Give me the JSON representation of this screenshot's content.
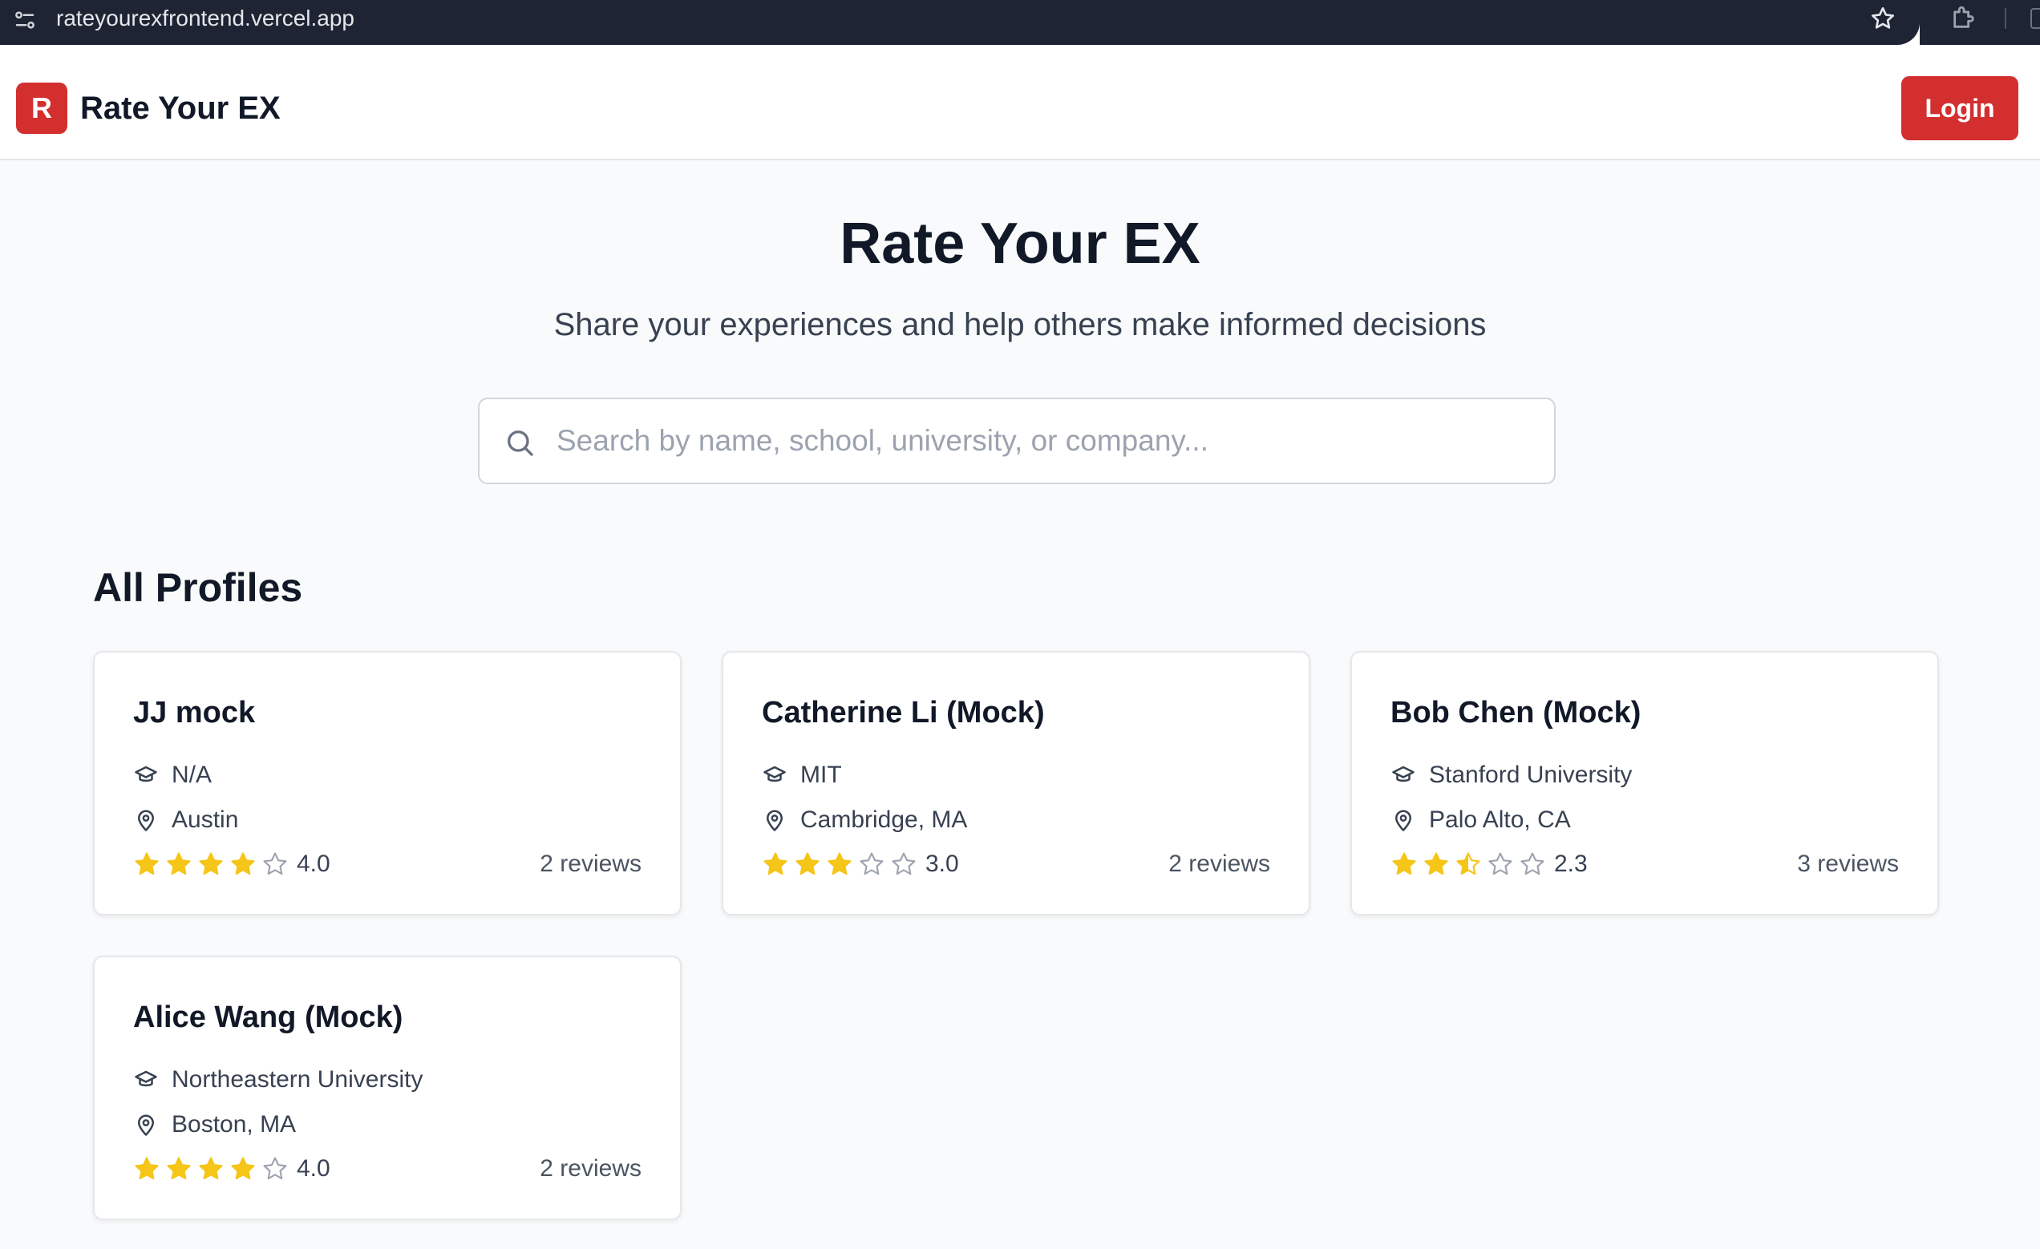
{
  "browser": {
    "url": "rateyourexfrontend.vercel.app",
    "icons": [
      "site-settings-icon",
      "star-icon",
      "extensions-icon"
    ]
  },
  "header": {
    "logo_letter": "R",
    "logo_text": "Rate Your EX",
    "login_label": "Login",
    "accent_color": "#d32f2f"
  },
  "hero": {
    "title": "Rate Your EX",
    "subtitle": "Share your experiences and help others make informed decisions"
  },
  "search": {
    "placeholder": "Search by name, school, university, or company...",
    "value": ""
  },
  "section_title": "All Profiles",
  "profiles": [
    {
      "name": "JJ mock",
      "school": "N/A",
      "location": "Austin",
      "rating": 4.0,
      "rating_label": "4.0",
      "reviews": "2 reviews"
    },
    {
      "name": "Catherine Li (Mock)",
      "school": "MIT",
      "location": "Cambridge, MA",
      "rating": 3.0,
      "rating_label": "3.0",
      "reviews": "2 reviews"
    },
    {
      "name": "Bob Chen (Mock)",
      "school": "Stanford University",
      "location": "Palo Alto, CA",
      "rating": 2.3,
      "rating_label": "2.3",
      "reviews": "3 reviews"
    },
    {
      "name": "Alice Wang (Mock)",
      "school": "Northeastern University",
      "location": "Boston, MA",
      "rating": 4.0,
      "rating_label": "4.0",
      "reviews": "2 reviews"
    }
  ],
  "colors": {
    "star_filled": "#f5c518",
    "star_empty": "#9ca3af"
  }
}
